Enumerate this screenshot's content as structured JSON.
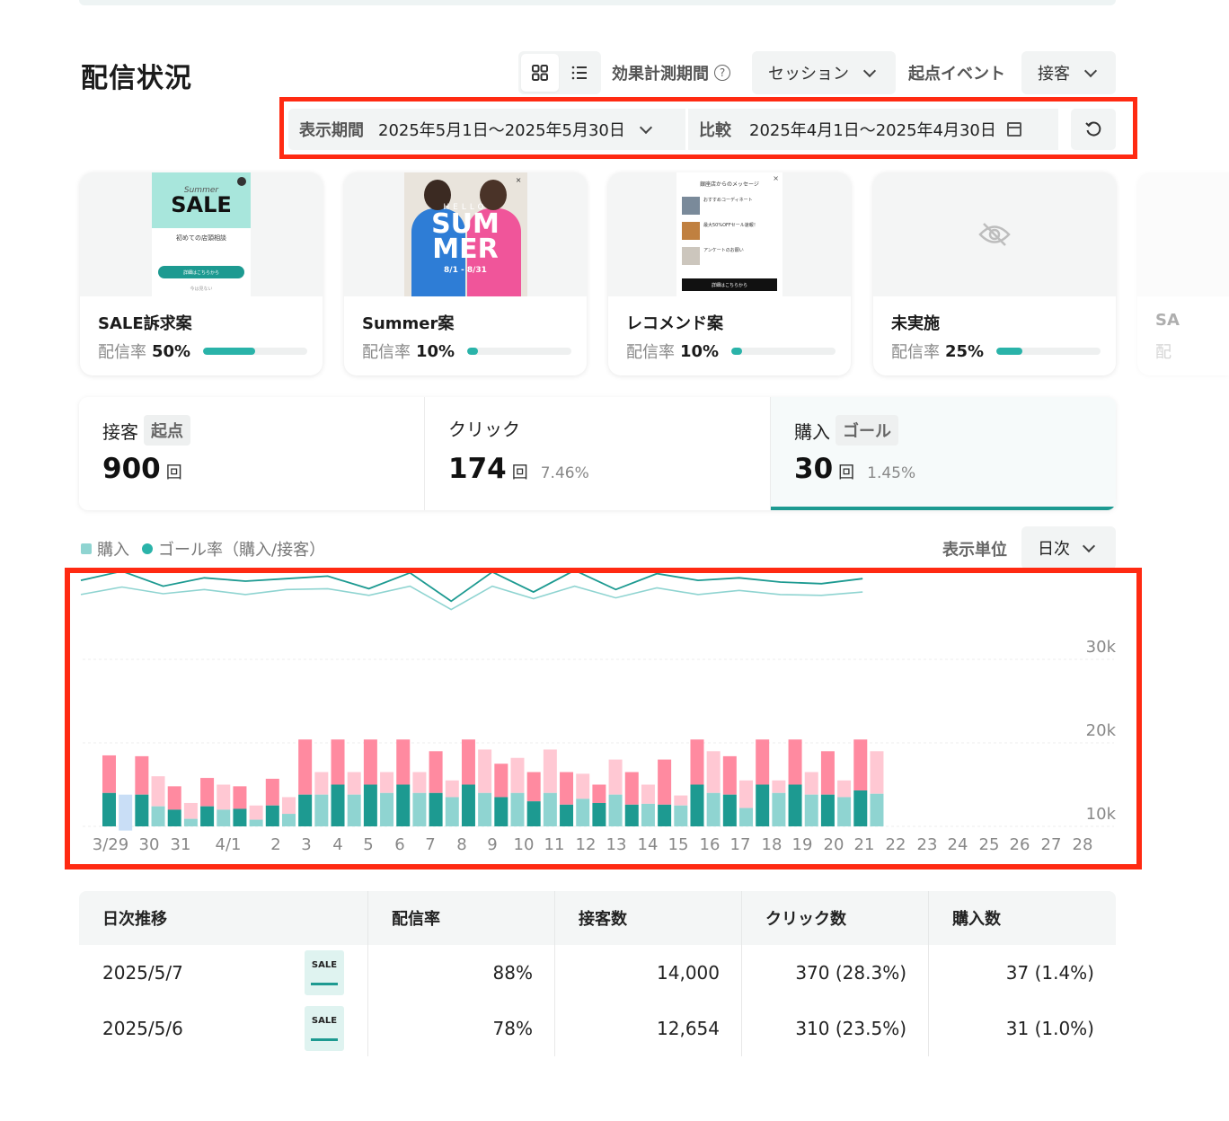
{
  "page": {
    "title": "配信状況"
  },
  "controls": {
    "measure_label": "効果計測期間",
    "measure_value": "セッション",
    "start_event_label": "起点イベント",
    "start_event_value": "接客"
  },
  "period": {
    "label": "表示期間",
    "value": "2025年5月1日〜2025年5月30日",
    "compare_label": "比較",
    "compare_value": "2025年4月1日〜2025年4月30日"
  },
  "cards": [
    {
      "title": "SALE訴求案",
      "rate_label": "配信率",
      "rate": "50%",
      "fraction": 0.5,
      "img": {
        "script": "Summer",
        "headline": "SALE",
        "sub": "初めての店頭相談",
        "cta": "詳細はこちらから",
        "foot": "今は見ない"
      }
    },
    {
      "title": "Summer案",
      "rate_label": "配信率",
      "rate": "10%",
      "fraction": 0.1,
      "img": {
        "word1": "HELLO",
        "word2": "SUM",
        "word3": "MER",
        "dates": "8/1 - 8/31"
      }
    },
    {
      "title": "レコメンド案",
      "rate_label": "配信率",
      "rate": "10%",
      "fraction": 0.1,
      "img": {
        "head": "銀座店からのメッセージ",
        "i1": "おすすめコーディネート",
        "i2": "最大50%OFFセール速報！",
        "i3": "アンケートのお願い",
        "cta": "詳細はこちらから"
      }
    },
    {
      "title": "未実施",
      "rate_label": "配信率",
      "rate": "25%",
      "fraction": 0.25
    },
    {
      "title": "SA",
      "rate_label": "配"
    }
  ],
  "metrics": [
    {
      "label": "接客",
      "tag": "起点",
      "value": "900",
      "unit": "回",
      "pct": ""
    },
    {
      "label": "クリック",
      "tag": "",
      "value": "174",
      "unit": "回",
      "pct": "7.46%"
    },
    {
      "label": "購入",
      "tag": "ゴール",
      "value": "30",
      "unit": "回",
      "pct": "1.45%"
    }
  ],
  "legend": {
    "bars": "購入",
    "line": "ゴール率（購入/接客）"
  },
  "display_unit": {
    "label": "表示単位",
    "value": "日次"
  },
  "chart_data": {
    "type": "bar",
    "y_ticks": [
      "30k",
      "20k",
      "10k"
    ],
    "ylim": [
      10000,
      30000
    ],
    "categories": [
      "3/29",
      "30",
      "31",
      "4/1",
      "",
      "2",
      "3",
      "4",
      "5",
      "6",
      "7",
      "8",
      "9",
      "10",
      "11",
      "12",
      "13",
      "14",
      "15",
      "16",
      "17",
      "18",
      "19",
      "20",
      "21",
      "22",
      "23",
      "24",
      "25",
      "26",
      "27",
      "28"
    ],
    "series": [
      {
        "values": [
          [
            18500,
            14000
          ],
          [
            13800,
            9500
          ],
          [
            18400,
            13800
          ],
          [
            16000,
            12400
          ],
          [
            14800,
            12000
          ],
          [
            12800,
            10900
          ],
          [
            15800,
            12400
          ],
          [
            15000,
            12000
          ],
          [
            14800,
            12100
          ],
          [
            12500,
            10800
          ],
          [
            15700,
            12500
          ],
          [
            13500,
            11500
          ],
          [
            20400,
            13800
          ],
          [
            16500,
            13800
          ],
          [
            20400,
            15000
          ],
          [
            16500,
            13800
          ],
          [
            20400,
            15000
          ],
          [
            16500,
            14000
          ],
          [
            20400,
            15000
          ],
          [
            16500,
            14000
          ],
          [
            19000,
            14000
          ],
          [
            15500,
            13500
          ],
          [
            20400,
            15000
          ],
          [
            19200,
            14000
          ],
          [
            17500,
            13500
          ],
          [
            18200,
            14000
          ],
          [
            16500,
            13000
          ],
          [
            19200,
            14000
          ],
          [
            16500,
            12600
          ],
          [
            16300,
            13300
          ],
          [
            15000,
            12800
          ],
          [
            18000,
            13800
          ],
          [
            16500,
            12600
          ],
          [
            15000,
            12700
          ],
          [
            18000,
            12600
          ],
          [
            13700,
            12500
          ],
          [
            20400,
            15000
          ],
          [
            19000,
            14000
          ],
          [
            18400,
            13800
          ],
          [
            15500,
            12200
          ],
          [
            20400,
            15000
          ],
          [
            15500,
            14000
          ],
          [
            20400,
            15000
          ],
          [
            16500,
            13800
          ],
          [
            19000,
            13800
          ],
          [
            15500,
            13500
          ],
          [
            20400,
            14300
          ],
          [
            19000,
            13900
          ]
        ]
      },
      {
        "values": [
          28700,
          29800,
          28000,
          29000,
          28600,
          28900,
          29200,
          27700,
          29600,
          26200,
          29700,
          27300,
          29900,
          27600,
          29500,
          28700,
          29000,
          28500,
          28300,
          28900
        ]
      },
      {
        "values": [
          27000,
          27900,
          27100,
          27600,
          27000,
          27600,
          27700,
          26900,
          28000,
          25200,
          28000,
          26500,
          28000,
          26600,
          27800,
          27000,
          27500,
          27000,
          26900,
          27300
        ]
      }
    ]
  },
  "table": {
    "headers": [
      "日次推移",
      "配信率",
      "接客数",
      "クリック数",
      "購入数"
    ],
    "rows": [
      {
        "date": "2025/5/7",
        "rate": "88%",
        "visits": "14,000",
        "clicks": "370 (28.3%)",
        "purchases": "37 (1.4%)"
      },
      {
        "date": "2025/5/6",
        "rate": "78%",
        "visits": "12,654",
        "clicks": "310 (23.5%)",
        "purchases": "31 (1.0%)"
      }
    ],
    "thumb_text": "SALE"
  },
  "colors": {
    "teal": "#1d9a91",
    "teal_light": "#8fd4d1",
    "pink": "#ff8aa0",
    "pink_light": "#ffc8d3",
    "red_outline": "#ff2a12"
  }
}
